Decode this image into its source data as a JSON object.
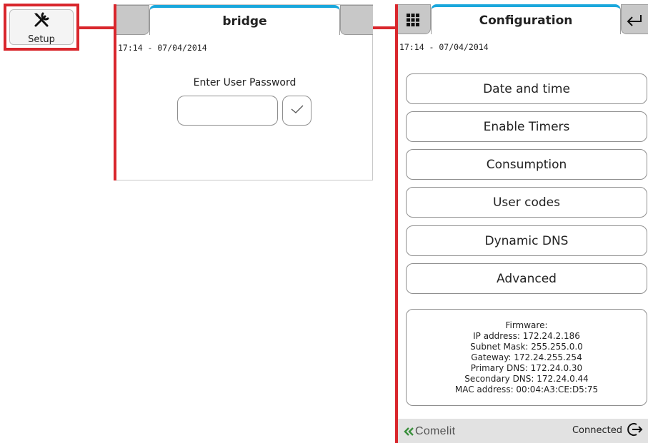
{
  "setup": {
    "label": "Setup",
    "icon": "tools-icon"
  },
  "bridge": {
    "title": "bridge",
    "timestamp": "17:14 - 07/04/2014",
    "password_prompt": "Enter User Password",
    "password_value": "",
    "confirm_icon": "check-icon"
  },
  "config": {
    "title": "Configuration",
    "timestamp": "17:14 - 07/04/2014",
    "menu_icon": "grid-icon",
    "back_icon": "return-icon",
    "items": [
      {
        "label": "Date and time"
      },
      {
        "label": "Enable Timers"
      },
      {
        "label": "Consumption"
      },
      {
        "label": "User codes"
      },
      {
        "label": "Dynamic DNS"
      },
      {
        "label": "Advanced"
      }
    ],
    "info": {
      "firmware": "Firmware:",
      "ip": "IP address: 172.24.2.186",
      "subnet": "Subnet Mask: 255.255.0.0",
      "gateway": "Gateway: 172.24.255.254",
      "dns1": "Primary DNS: 172.24.0.30",
      "dns2": "Secondary DNS: 172.24.0.44",
      "mac": "MAC address: 00:04:A3:CE:D5:75"
    },
    "footer": {
      "brand": "Comelit",
      "status": "Connected",
      "logout_icon": "logout-icon"
    }
  },
  "colors": {
    "highlight": "#d9262c",
    "tab_accent": "#1aa7dc",
    "brand_green": "#3a8f3c"
  }
}
